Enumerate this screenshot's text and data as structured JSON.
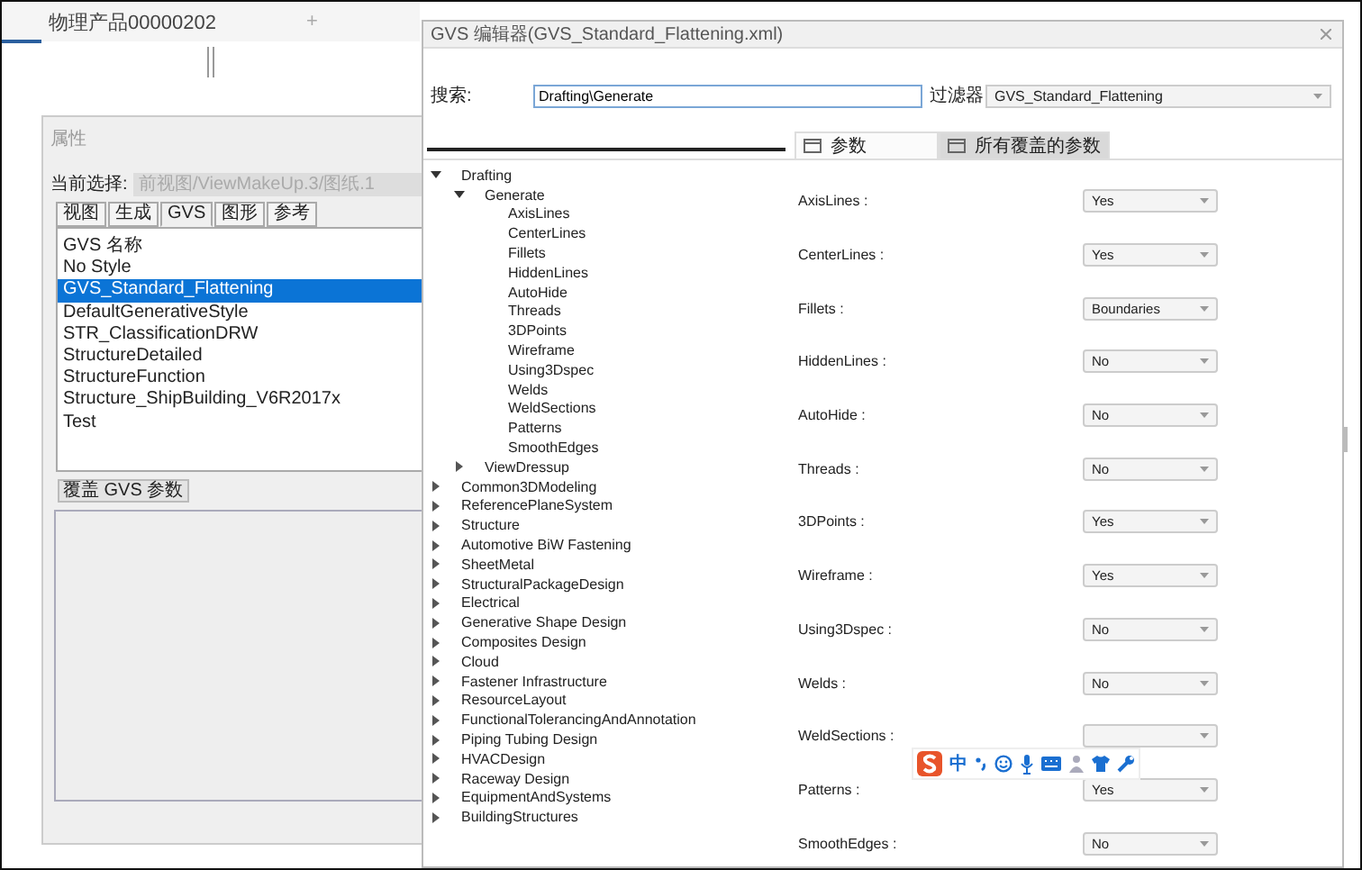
{
  "app_tab": {
    "label": "物理产品00000202",
    "add": "+"
  },
  "properties_panel": {
    "title": "属性",
    "current_label": "当前选择:",
    "current_value": "前视图/ViewMakeUp.3/图纸.1",
    "current_disabled": true,
    "tabs": [
      {
        "label": "视图",
        "selected": false
      },
      {
        "label": "生成",
        "selected": false
      },
      {
        "label": "GVS",
        "selected": true
      },
      {
        "label": "图形",
        "selected": false
      },
      {
        "label": "参考",
        "selected": false
      }
    ],
    "list": [
      {
        "label": "GVS 名称",
        "selected": false
      },
      {
        "label": "No Style",
        "selected": false
      },
      {
        "label": "GVS_Standard_Flattening",
        "selected": true
      },
      {
        "label": "DefaultGenerativeStyle",
        "selected": false
      },
      {
        "label": "STR_ClassificationDRW",
        "selected": false
      },
      {
        "label": "StructureDetailed",
        "selected": false
      },
      {
        "label": "StructureFunction",
        "selected": false
      },
      {
        "label": "Structure_ShipBuilding_V6R2017x",
        "selected": false
      },
      {
        "label": "Test",
        "selected": false
      }
    ],
    "override_button": "覆盖 GVS 参数"
  },
  "dialog": {
    "title": "GVS 编辑器(GVS_Standard_Flattening.xml)",
    "search_label": "搜索:",
    "search_value": "Drafting\\Generate",
    "filter_label": "过滤器",
    "filter_value": "GVS_Standard_Flattening",
    "tabs": [
      {
        "label": "参数",
        "selected": true
      },
      {
        "label": "所有覆盖的参数",
        "selected": false
      }
    ],
    "tree": [
      {
        "label": "Drafting",
        "expanded": true,
        "children": [
          {
            "label": "Generate",
            "expanded": true,
            "children": [
              {
                "label": "AxisLines"
              },
              {
                "label": "CenterLines"
              },
              {
                "label": "Fillets"
              },
              {
                "label": "HiddenLines"
              },
              {
                "label": "AutoHide"
              },
              {
                "label": "Threads"
              },
              {
                "label": "3DPoints"
              },
              {
                "label": "Wireframe"
              },
              {
                "label": "Using3Dspec"
              },
              {
                "label": "Welds"
              },
              {
                "label": "WeldSections"
              },
              {
                "label": "Patterns"
              },
              {
                "label": "SmoothEdges"
              }
            ]
          },
          {
            "label": "ViewDressup",
            "expanded": false
          }
        ]
      },
      {
        "label": "Common3DModeling",
        "expanded": false
      },
      {
        "label": "ReferencePlaneSystem",
        "expanded": false
      },
      {
        "label": "Structure",
        "expanded": false
      },
      {
        "label": "Automotive BiW Fastening",
        "expanded": false
      },
      {
        "label": "SheetMetal",
        "expanded": false
      },
      {
        "label": "StructuralPackageDesign",
        "expanded": false
      },
      {
        "label": "Electrical",
        "expanded": false
      },
      {
        "label": "Generative Shape Design",
        "expanded": false
      },
      {
        "label": "Composites Design",
        "expanded": false
      },
      {
        "label": "Cloud",
        "expanded": false
      },
      {
        "label": "Fastener Infrastructure",
        "expanded": false
      },
      {
        "label": "ResourceLayout",
        "expanded": false
      },
      {
        "label": "FunctionalTolerancingAndAnnotation",
        "expanded": false
      },
      {
        "label": "Piping Tubing Design",
        "expanded": false
      },
      {
        "label": "HVACDesign",
        "expanded": false
      },
      {
        "label": "Raceway Design",
        "expanded": false
      },
      {
        "label": "EquipmentAndSystems",
        "expanded": false
      },
      {
        "label": "BuildingStructures",
        "expanded": false
      }
    ],
    "parameters": [
      {
        "label": "AxisLines :",
        "value": "Yes"
      },
      {
        "label": "CenterLines :",
        "value": "Yes"
      },
      {
        "label": "Fillets :",
        "value": "Boundaries"
      },
      {
        "label": "HiddenLines :",
        "value": "No"
      },
      {
        "label": "AutoHide :",
        "value": "No"
      },
      {
        "label": "Threads :",
        "value": "No"
      },
      {
        "label": "3DPoints :",
        "value": "Yes"
      },
      {
        "label": "Wireframe :",
        "value": "Yes"
      },
      {
        "label": "Using3Dspec :",
        "value": "No"
      },
      {
        "label": "Welds :",
        "value": "No"
      },
      {
        "label": "WeldSections :"
      },
      {
        "label": "Patterns :",
        "value": "Yes"
      },
      {
        "label": "SmoothEdges :",
        "value": "No"
      }
    ]
  },
  "ime_toolbar": {
    "mode": "中"
  }
}
